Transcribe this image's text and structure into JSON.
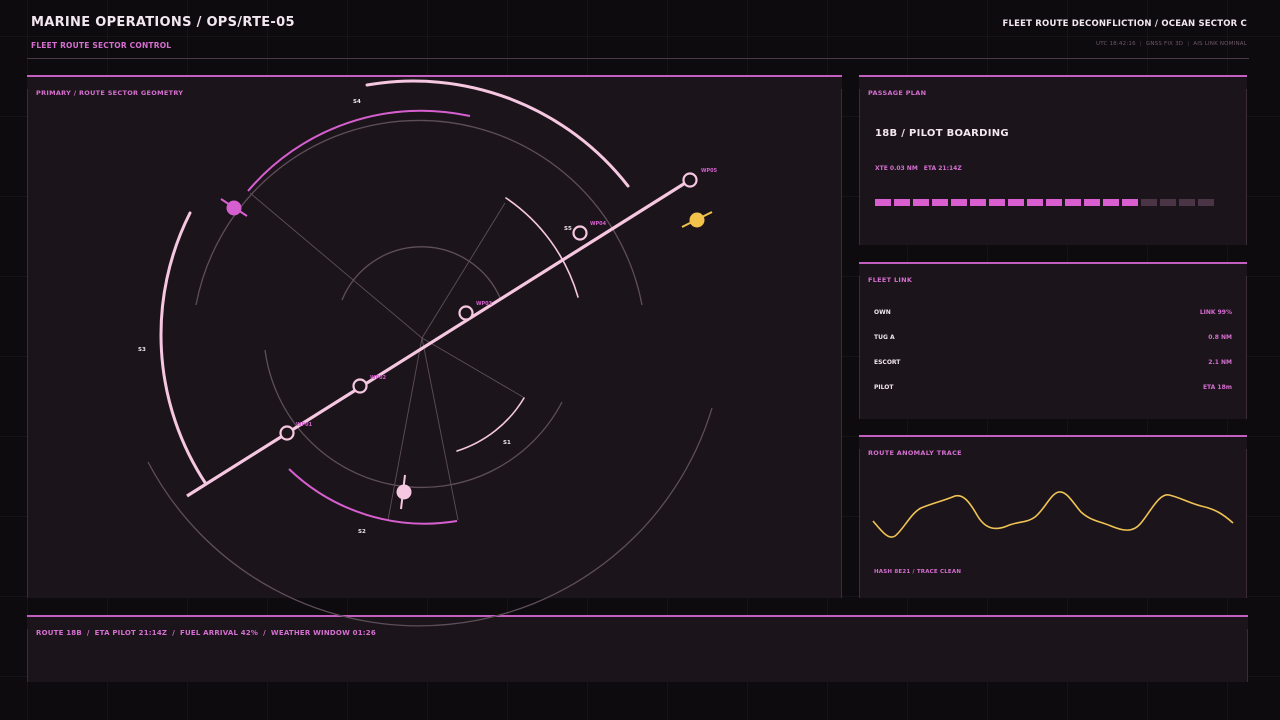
{
  "header": {
    "title": "MARINE OPERATIONS / OPS/RTE-05",
    "subtitle": "FLEET ROUTE SECTOR CONTROL",
    "right_title": "FLEET ROUTE DECONFLICTION / OCEAN SECTOR C",
    "status": [
      "UTC 18:42:16",
      "GNSS FIX 3D",
      "AIS LINK NOMINAL"
    ]
  },
  "geometry_panel": {
    "label": "PRIMARY / ROUTE SECTOR GEOMETRY",
    "sectors": [
      "S1",
      "S2",
      "S3",
      "S4",
      "S5"
    ],
    "waypoints": [
      "WP01",
      "WP02",
      "WP03",
      "WP04",
      "WP05"
    ]
  },
  "passage_plan": {
    "label": "PASSAGE PLAN",
    "title": "18B / PILOT BOARDING",
    "xte": "XTE 0.03 NM",
    "eta": "ETA 21:14Z",
    "progress_segments_total": 18,
    "progress_segments_filled": 14
  },
  "fleet_link": {
    "label": "FLEET LINK",
    "rows": [
      {
        "name": "OWN",
        "value": "LINK 99%"
      },
      {
        "name": "TUG A",
        "value": "0.8 NM"
      },
      {
        "name": "ESCORT",
        "value": "2.1 NM"
      },
      {
        "name": "PILOT",
        "value": "ETA 18m"
      }
    ]
  },
  "anomaly_trace": {
    "label": "ROUTE ANOMALY TRACE",
    "footer": "HASH 8E21 / TRACE CLEAN"
  },
  "bottom_bar": {
    "route": "ROUTE 18B",
    "eta": "ETA PILOT 21:14Z",
    "fuel": "FUEL ARRIVAL 42%",
    "weather": "WEATHER WINDOW 01:26"
  },
  "colors": {
    "accent": "#d56fd0",
    "route": "#f6c7e0",
    "warning": "#f3c24a",
    "panel": "#1c141b"
  }
}
